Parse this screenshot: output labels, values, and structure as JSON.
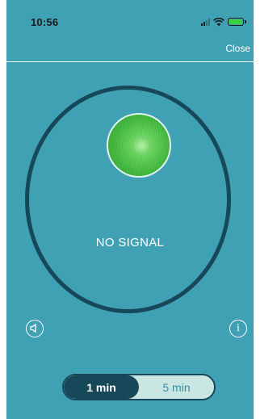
{
  "status_bar": {
    "time": "10:56"
  },
  "header": {
    "close_label": "Close"
  },
  "monitor": {
    "status_text": "NO SIGNAL"
  },
  "icons": {
    "sound": "speaker-icon",
    "info": "info-icon",
    "info_glyph": "i"
  },
  "duration_toggle": {
    "options": [
      {
        "label": "1 min",
        "selected": true
      },
      {
        "label": "5 min",
        "selected": false
      }
    ]
  },
  "colors": {
    "background": "#3fa1b3",
    "ring": "#17485a",
    "toggle_active": "#17485a",
    "toggle_inactive_bg": "#c9e6e3",
    "camera_preview": "#4cc246",
    "battery_fill": "#36d13c"
  }
}
